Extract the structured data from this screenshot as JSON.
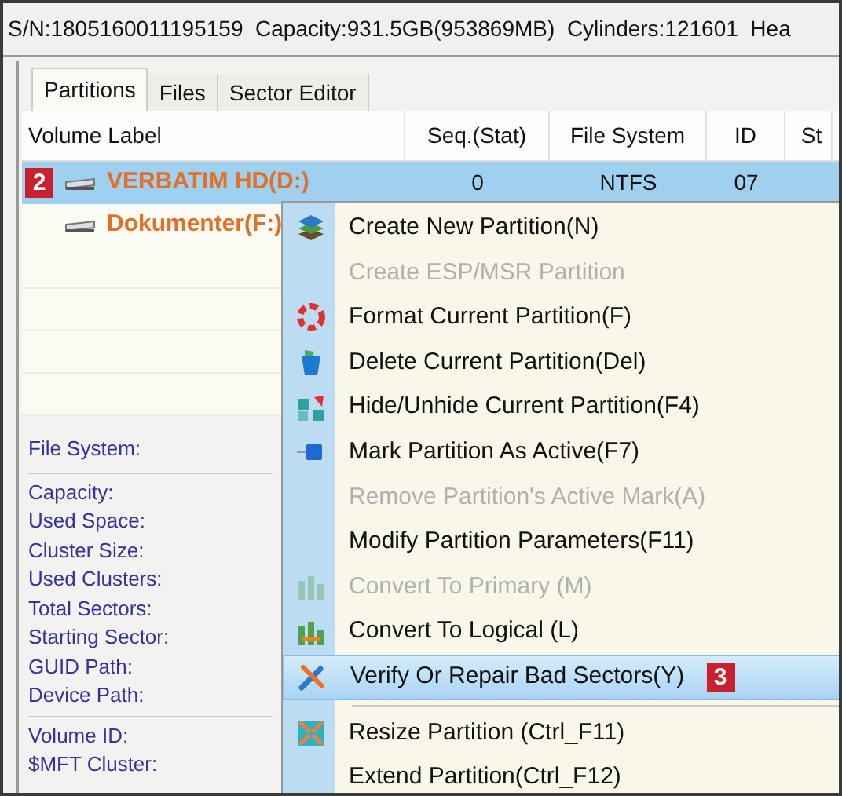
{
  "header": {
    "text": "S/N:1805160011195159  Capacity:931.5GB(953869MB)  Cylinders:121601  Hea"
  },
  "tabs": [
    {
      "label": "Partitions",
      "selected": true
    },
    {
      "label": "Files",
      "selected": false
    },
    {
      "label": "Sector Editor",
      "selected": false
    }
  ],
  "table": {
    "columns": [
      "Volume Label",
      "Seq.(Stat)",
      "File System",
      "ID",
      "St"
    ],
    "rows": [
      {
        "cells": [
          "VERBATIM HD(D:)",
          "0",
          "NTFS",
          "07"
        ],
        "selected": true,
        "badge": "2"
      },
      {
        "cells": [
          "Dokumenter(F:)"
        ],
        "selected": false
      }
    ]
  },
  "info": {
    "groups": [
      [
        "File System:"
      ],
      [
        "Capacity:",
        "Used Space:",
        "Cluster Size:",
        "Used Clusters:",
        "Total Sectors:",
        "Starting Sector:",
        "GUID Path:",
        "Device Path:"
      ],
      [
        "Volume ID:",
        "$MFT Cluster:"
      ]
    ]
  },
  "menu": [
    {
      "kind": "item",
      "label": "Create New Partition(N)",
      "disabled": false,
      "selected": false
    },
    {
      "kind": "item",
      "label": "Create ESP/MSR Partition",
      "disabled": true,
      "selected": false
    },
    {
      "kind": "item",
      "label": "Format Current Partition(F)",
      "disabled": false,
      "selected": false
    },
    {
      "kind": "item",
      "label": "Delete Current Partition(Del)",
      "disabled": false,
      "selected": false
    },
    {
      "kind": "item",
      "label": "Hide/Unhide Current Partition(F4)",
      "disabled": false,
      "selected": false
    },
    {
      "kind": "item",
      "label": "Mark Partition As Active(F7)",
      "disabled": false,
      "selected": false
    },
    {
      "kind": "item",
      "label": "Remove Partition's Active Mark(A)",
      "disabled": true,
      "selected": false
    },
    {
      "kind": "item",
      "label": "Modify Partition Parameters(F11)",
      "disabled": false,
      "selected": false
    },
    {
      "kind": "item",
      "label": "Convert To Primary (M)",
      "disabled": true,
      "selected": false
    },
    {
      "kind": "item",
      "label": "Convert To Logical (L)",
      "disabled": false,
      "selected": false
    },
    {
      "kind": "item",
      "label": "Verify Or Repair Bad Sectors(Y)",
      "disabled": false,
      "selected": true,
      "badge": "3"
    },
    {
      "kind": "separator"
    },
    {
      "kind": "item",
      "label": "Resize Partition (Ctrl_F11)",
      "disabled": false,
      "selected": false
    },
    {
      "kind": "item",
      "label": "Extend Partition(Ctrl_F12)",
      "disabled": false,
      "selected": false
    }
  ]
}
